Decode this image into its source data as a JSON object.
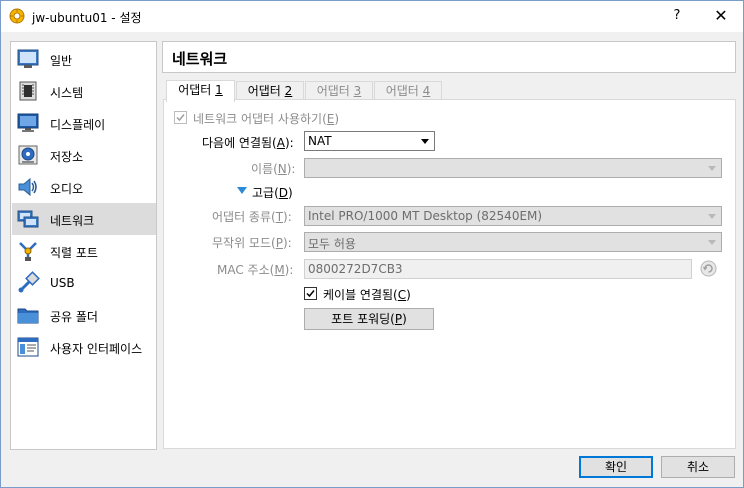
{
  "window": {
    "title": "jw-ubuntu01 - 설정",
    "help_label": "?",
    "close_label": "✕"
  },
  "sidebar": {
    "items": [
      {
        "label": "일반",
        "icon": "general-icon"
      },
      {
        "label": "시스템",
        "icon": "system-icon"
      },
      {
        "label": "디스플레이",
        "icon": "display-icon"
      },
      {
        "label": "저장소",
        "icon": "storage-icon"
      },
      {
        "label": "오디오",
        "icon": "audio-icon"
      },
      {
        "label": "네트워크",
        "icon": "network-icon",
        "selected": true
      },
      {
        "label": "직렬 포트",
        "icon": "serial-port-icon"
      },
      {
        "label": "USB",
        "icon": "usb-icon"
      },
      {
        "label": "공유 폴더",
        "icon": "shared-folder-icon"
      },
      {
        "label": "사용자 인터페이스",
        "icon": "user-interface-icon"
      }
    ]
  },
  "header": {
    "title": "네트워크"
  },
  "tabs": [
    {
      "label": "어댑터 ",
      "num": "1",
      "state": "active"
    },
    {
      "label": "어댑터 ",
      "num": "2",
      "state": "enabled"
    },
    {
      "label": "어댑터 ",
      "num": "3",
      "state": "disabled"
    },
    {
      "label": "어댑터 ",
      "num": "4",
      "state": "disabled"
    }
  ],
  "form": {
    "enable_adapter": {
      "label": "네트워크 어댑터 사용하기(",
      "key": "E",
      "suffix": ")",
      "checked": true
    },
    "attached_to": {
      "label": "다음에 연결됨(",
      "key": "A",
      "suffix": "):",
      "value": "NAT"
    },
    "name": {
      "label": "이름(",
      "key": "N",
      "suffix": "):",
      "value": ""
    },
    "advanced": {
      "label": "고급(",
      "key": "D",
      "suffix": ")"
    },
    "adapter_type": {
      "label": "어댑터 종류(",
      "key": "T",
      "suffix": "):",
      "value": "Intel PRO/1000 MT Desktop (82540EM)"
    },
    "promiscuous": {
      "label": "무작위 모드(",
      "key": "P",
      "suffix": "):",
      "value": "모두 허용"
    },
    "mac": {
      "label": "MAC 주소(",
      "key": "M",
      "suffix": "):",
      "value": "0800272D7CB3"
    },
    "cable": {
      "label": "케이블 연결됨(",
      "key": "C",
      "suffix": ")",
      "checked": true
    },
    "port_forwarding": {
      "label": "포트 포워딩(",
      "key": "P",
      "suffix": ")"
    }
  },
  "footer": {
    "ok_label": "확인",
    "cancel_label": "취소"
  },
  "colors": {
    "selection": "#dcdcdc",
    "accent": "#0078d7",
    "disabled_text": "#8c8c8c"
  }
}
